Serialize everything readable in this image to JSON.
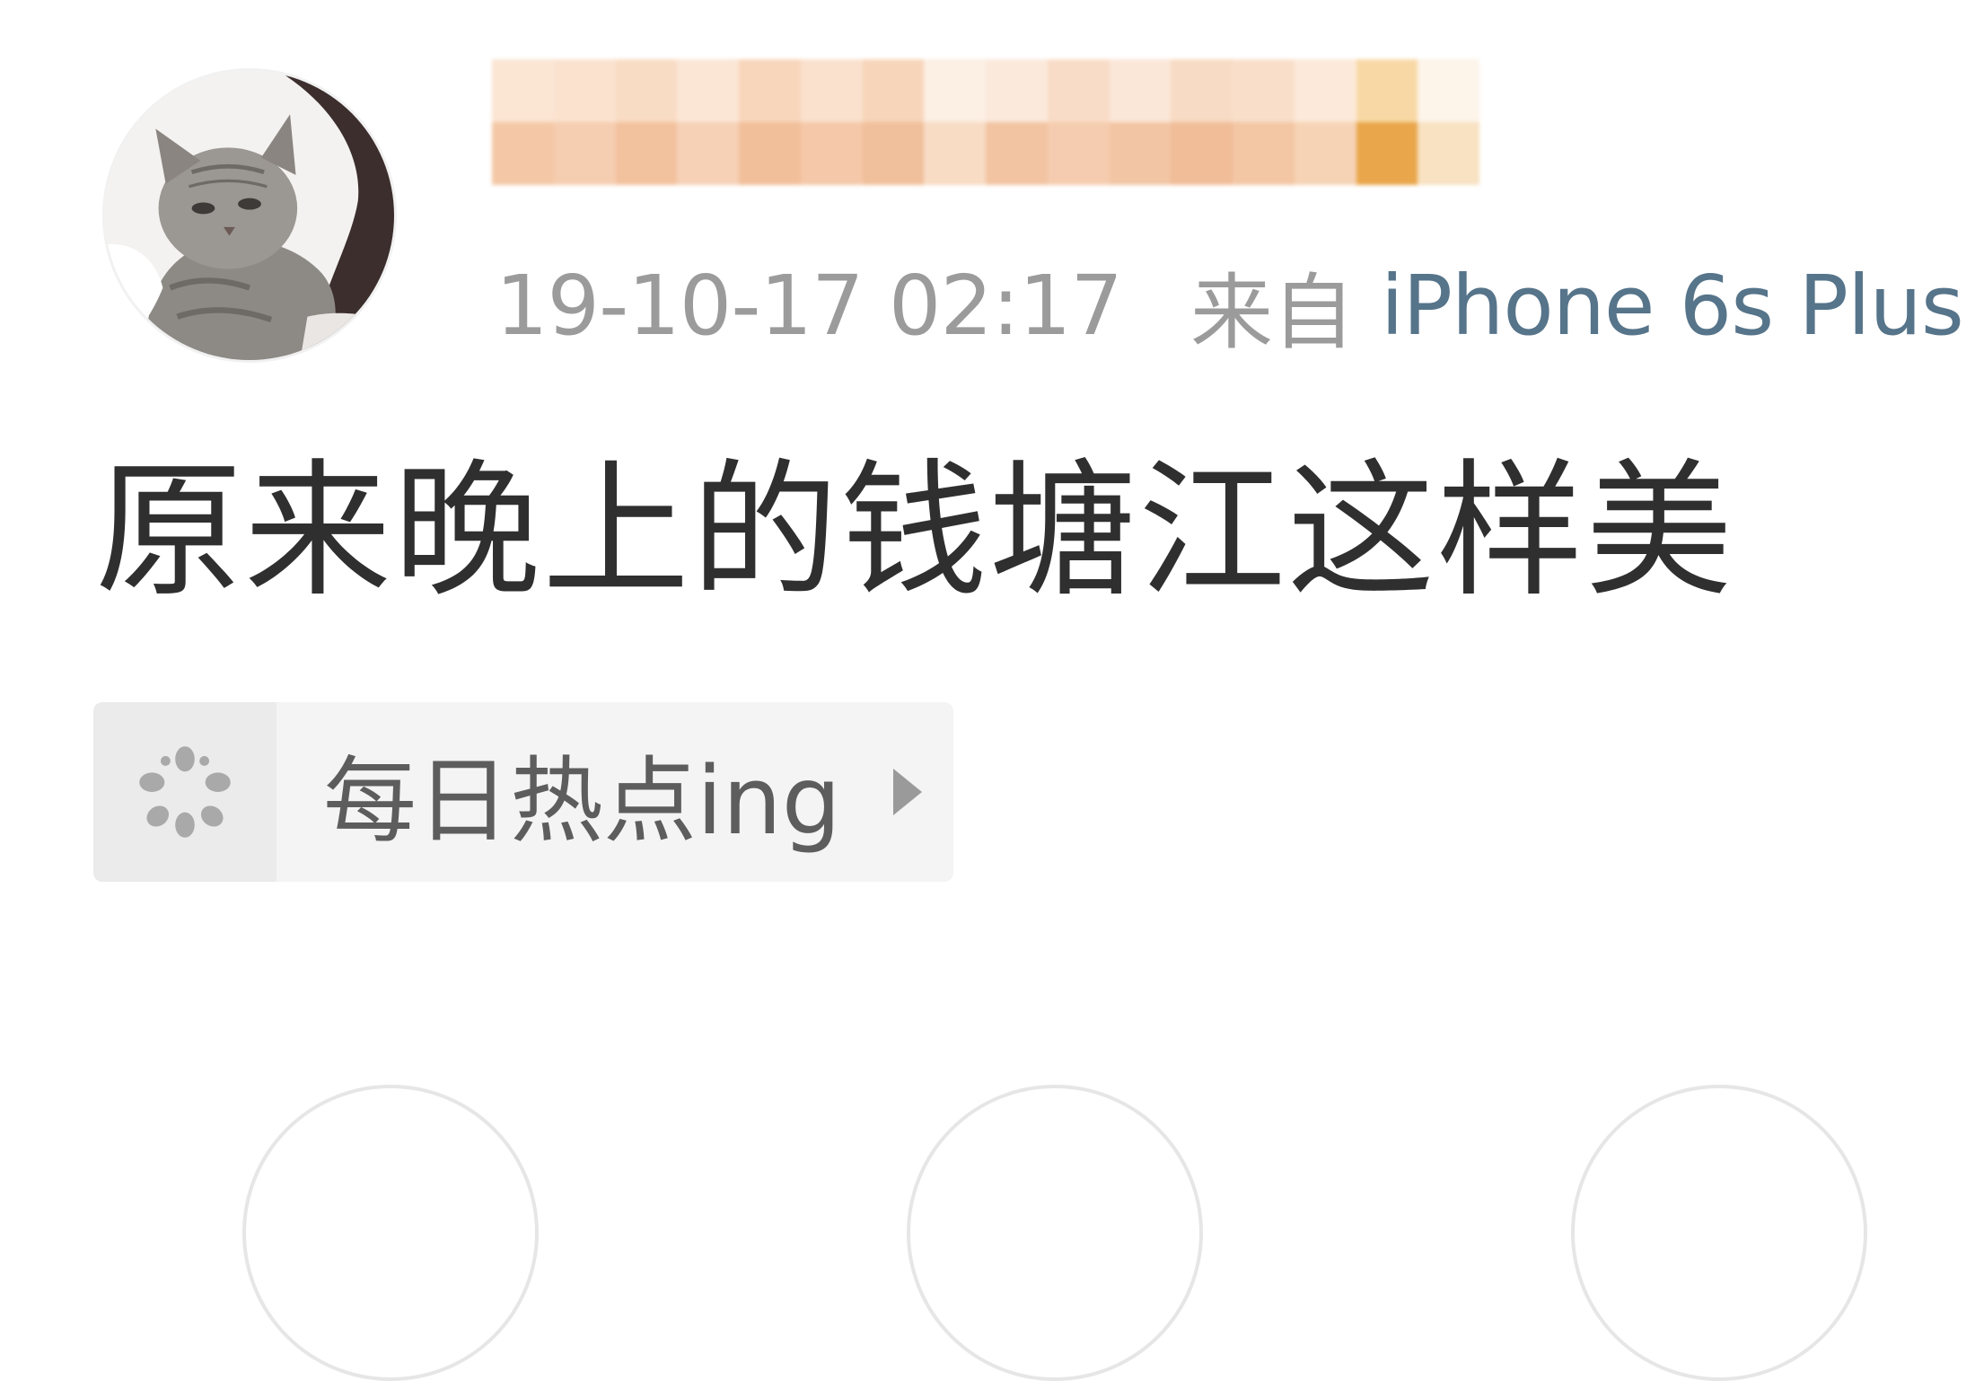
{
  "post": {
    "time": "19-10-17 02:17",
    "from_label": "来自",
    "device": "iPhone 6s Plus",
    "text": "原来晚上的钱塘江这样美"
  },
  "topic": {
    "label": "每日热点ing",
    "icon": "flower-dots-icon",
    "arrow_icon": "chevron-right-icon"
  },
  "colors": {
    "meta_gray": "#9b9b9b",
    "device_blue": "#56748a",
    "tag_bg": "#f4f4f4",
    "mosaic_orange": "#e9a64a"
  },
  "icons": {
    "avatar": "cat-avatar-icon",
    "username": "pixelated-username"
  }
}
